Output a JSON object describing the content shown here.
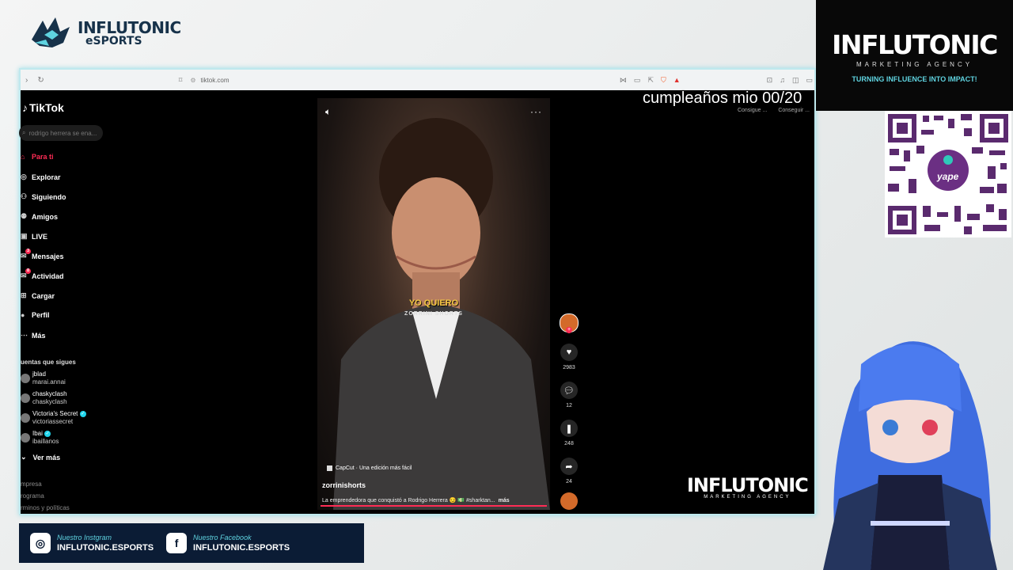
{
  "stream": {
    "logo_top": {
      "line1": "INFLUTONIC",
      "line2": "eSPORTS"
    },
    "overlay_text": "cumpleaños mio 00/20",
    "brand_panel": {
      "title": "INFLUTONIC",
      "subtitle": "MARKETING AGENCY",
      "tagline": "TURNING INFLUENCE INTO IMPACT!"
    },
    "qr_label": "yape",
    "brand_in_browser": {
      "title": "INFLUTONIC",
      "subtitle": "MARKETING AGENCY"
    },
    "socials": [
      {
        "platform": "Nuestro Instgram",
        "handle": "INFLUTONIC.ESPORTS",
        "icon": "instagram-icon"
      },
      {
        "platform": "Nuestro Facebook",
        "handle": "INFLUTONIC.ESPORTS",
        "icon": "facebook-icon"
      }
    ]
  },
  "browser": {
    "url": "tiktok.com"
  },
  "tiktok": {
    "logo": "TikTok",
    "search_placeholder": "rodrigo herrera se ena...",
    "nav": [
      {
        "label": "Para ti",
        "icon": "home-icon",
        "active": true
      },
      {
        "label": "Explorar",
        "icon": "compass-icon"
      },
      {
        "label": "Siguiendo",
        "icon": "following-icon"
      },
      {
        "label": "Amigos",
        "icon": "friends-icon"
      },
      {
        "label": "LIVE",
        "icon": "live-icon"
      },
      {
        "label": "Mensajes",
        "icon": "messages-icon",
        "badge": "3"
      },
      {
        "label": "Actividad",
        "icon": "activity-icon",
        "badge": "8"
      },
      {
        "label": "Cargar",
        "icon": "upload-icon"
      },
      {
        "label": "Perfil",
        "icon": "profile-icon"
      },
      {
        "label": "Más",
        "icon": "more-icon"
      }
    ],
    "following_header": "uentas que sigues",
    "following": [
      {
        "name": "jblad",
        "handle": "marai.annai"
      },
      {
        "name": "chaskyclash",
        "handle": "chaskyclash"
      },
      {
        "name": "Victoria's Secret",
        "handle": "victoriassecret",
        "verified": true
      },
      {
        "name": "Ibai",
        "handle": "ibaillanos",
        "verified": true
      }
    ],
    "see_more": "Ver más",
    "footer_links": [
      "mpresa",
      "rograma",
      "rminos y políticas"
    ],
    "top_tools": [
      "Consigue ...",
      "Conseguir ..."
    ],
    "video": {
      "caption_main": "YO QUIERO",
      "caption_sub": "ZORRINI SHORTS",
      "capcut": "CapCut · Una edición más fácil",
      "author": "zorrinishorts",
      "description": "La emprendedora que conquistó a Rodrigo Herrera 😏 💵 #sharktan...",
      "more": "más",
      "progress": 1.0
    },
    "actions": [
      {
        "icon": "heart-icon",
        "count": "2983"
      },
      {
        "icon": "comment-icon",
        "count": "12"
      },
      {
        "icon": "bookmark-icon",
        "count": "248"
      },
      {
        "icon": "share-icon",
        "count": "24"
      }
    ]
  }
}
